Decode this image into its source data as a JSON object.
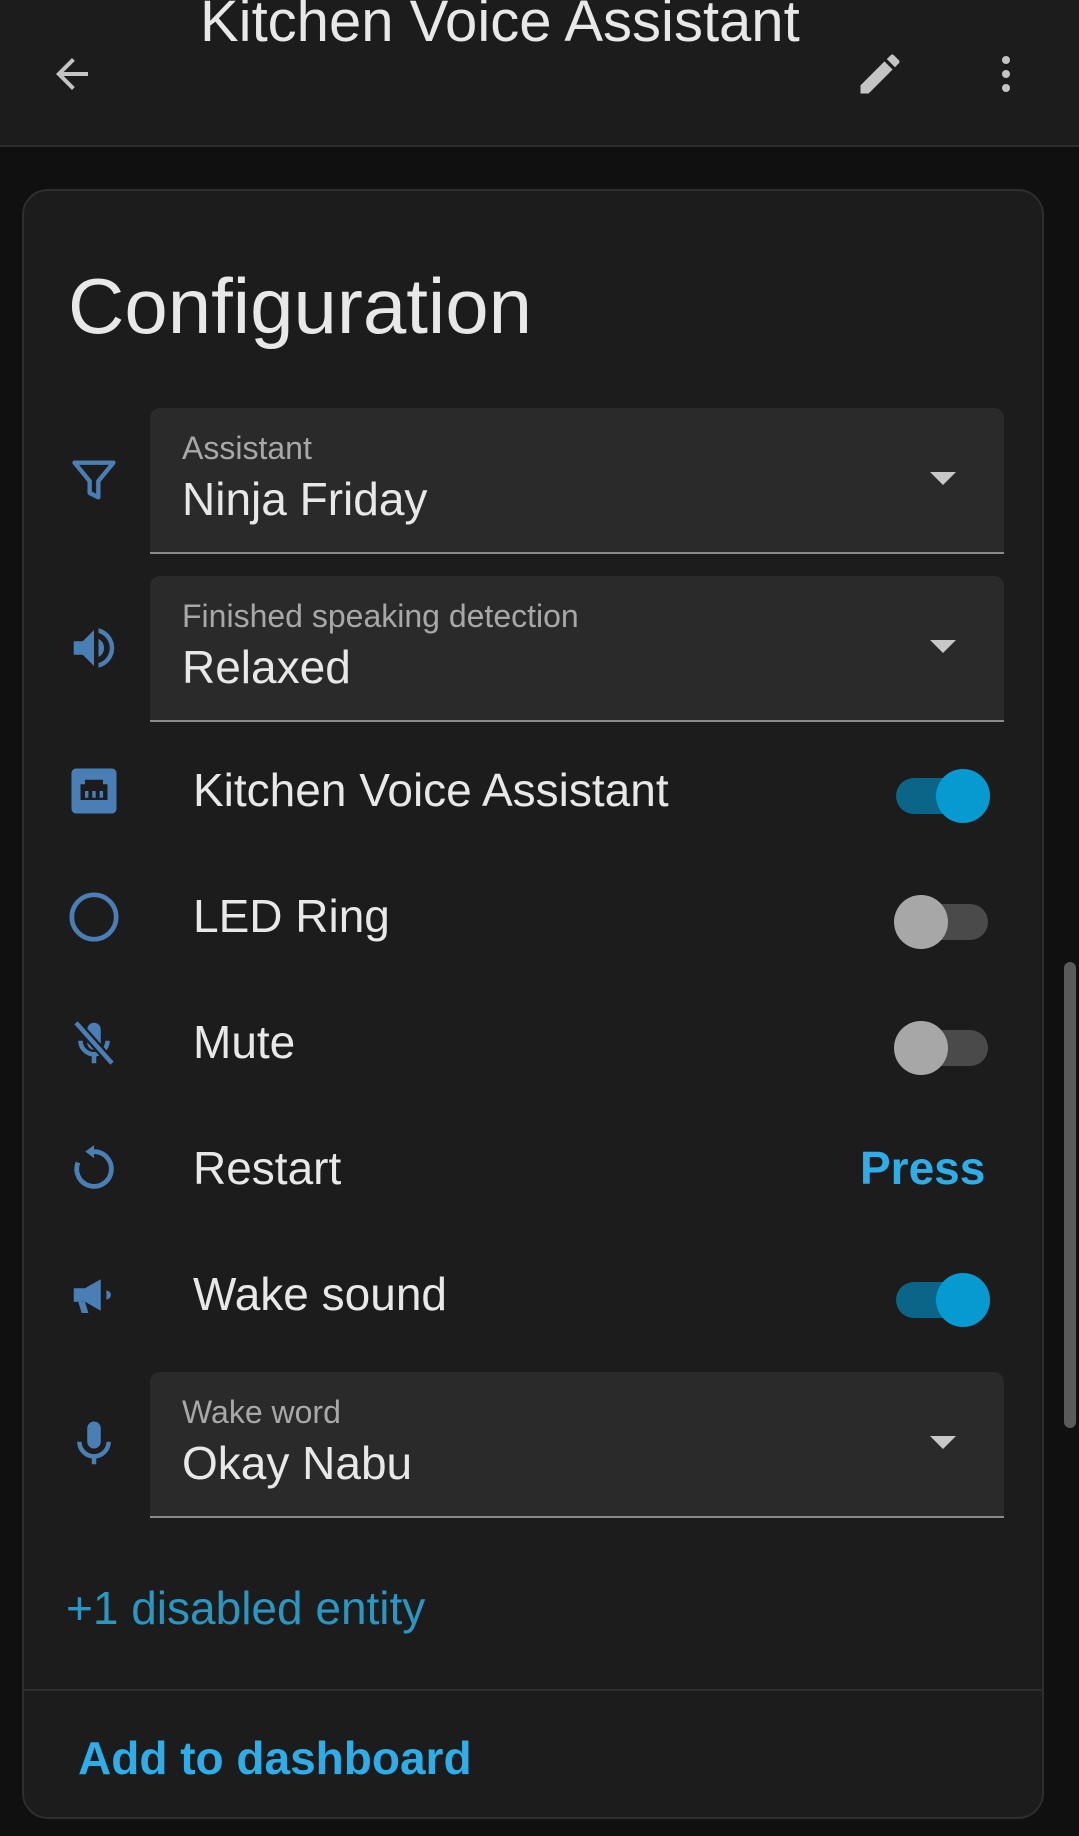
{
  "header": {
    "title": "Kitchen Voice Assistant",
    "back_icon": "arrow-left-icon",
    "edit_icon": "pencil-icon",
    "more_icon": "dots-vertical-icon"
  },
  "card": {
    "title": "Configuration",
    "assistant": {
      "label": "Assistant",
      "value": "Ninja Friday",
      "icon": "filter-icon"
    },
    "finished_speaking": {
      "label": "Finished speaking detection",
      "value": "Relaxed",
      "icon": "volume-icon"
    },
    "entities": [
      {
        "label": "Kitchen Voice Assistant",
        "icon": "ethernet-icon",
        "state": "on"
      },
      {
        "label": "LED Ring",
        "icon": "circle-outline-icon",
        "state": "off"
      },
      {
        "label": "Mute",
        "icon": "microphone-off-icon",
        "state": "off"
      },
      {
        "label": "Restart",
        "icon": "restart-icon",
        "action": "Press"
      },
      {
        "label": "Wake sound",
        "icon": "bullhorn-icon",
        "state": "on"
      }
    ],
    "wake_word": {
      "label": "Wake word",
      "value": "Okay Nabu",
      "icon": "microphone-icon"
    },
    "disabled_entities": "+1 disabled entity",
    "add_to_dashboard": "Add to dashboard"
  },
  "colors": {
    "accent": "#069ad1",
    "link": "#2eaee9",
    "icon": "#4a7fb5",
    "background": "#101010",
    "card": "#1c1c1c"
  }
}
